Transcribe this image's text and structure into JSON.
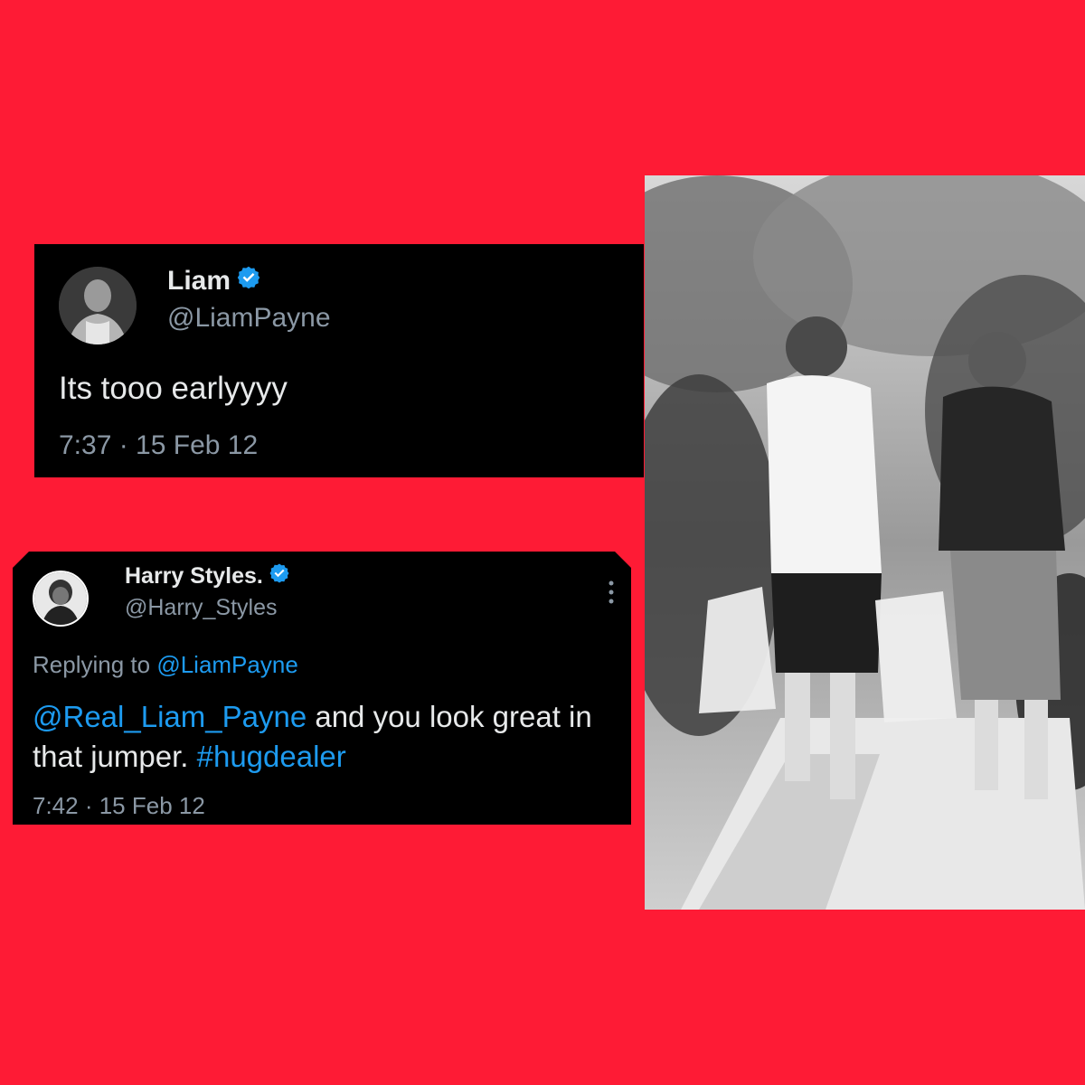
{
  "colors": {
    "background": "#fe1b35",
    "tweet_bg": "#000000",
    "text": "#e7e9ea",
    "muted": "#8b98a5",
    "accent": "#1d9bf0"
  },
  "tweet1": {
    "name": "Liam",
    "handle": "@LiamPayne",
    "text": "Its tooo earlyyyy",
    "timestamp": "7:37 · 15 Feb 12",
    "verified_icon": "verified-badge-icon"
  },
  "tweet2": {
    "name": "Harry Styles.",
    "handle": "@Harry_Styles",
    "replying_prefix": "Replying to ",
    "replying_handle": "@LiamPayne",
    "mention": "@Real_Liam_Payne",
    "text_line1_rest": " and you look great in",
    "text_line2": "that jumper. ",
    "hashtag": "#hugdealer",
    "timestamp": "7:42 · 15 Feb 12",
    "verified_icon": "verified-badge-icon",
    "more_icon": "more-options-icon"
  }
}
